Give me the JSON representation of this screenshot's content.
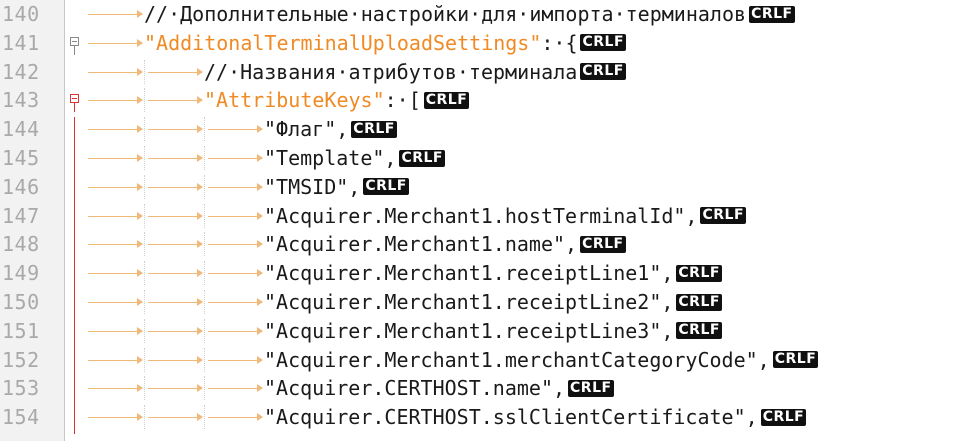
{
  "editor": {
    "eol_marker": "CRLF",
    "lines": [
      {
        "num": "140",
        "indent": 1,
        "fold": "",
        "parts": [
          {
            "type": "comment",
            "text": "//·Дополнительные·настройки·для·импорта·терминалов"
          }
        ]
      },
      {
        "num": "141",
        "indent": 1,
        "fold": "open-gray",
        "parts": [
          {
            "type": "key",
            "text": "\"AdditonalTerminalUploadSettings\""
          },
          {
            "type": "punct",
            "text": ":·{"
          }
        ]
      },
      {
        "num": "142",
        "indent": 2,
        "fold": "",
        "parts": [
          {
            "type": "comment",
            "text": "//·Названия·атрибутов·терминала"
          }
        ]
      },
      {
        "num": "143",
        "indent": 2,
        "fold": "open-red",
        "parts": [
          {
            "type": "key",
            "text": "\"AttributeKeys\""
          },
          {
            "type": "punct",
            "text": ":·["
          }
        ]
      },
      {
        "num": "144",
        "indent": 3,
        "fold": "line",
        "parts": [
          {
            "type": "str",
            "text": "\"Флаг\","
          }
        ]
      },
      {
        "num": "145",
        "indent": 3,
        "fold": "line",
        "parts": [
          {
            "type": "str",
            "text": "\"Template\","
          }
        ]
      },
      {
        "num": "146",
        "indent": 3,
        "fold": "line",
        "parts": [
          {
            "type": "str",
            "text": "\"TMSID\","
          }
        ]
      },
      {
        "num": "147",
        "indent": 3,
        "fold": "line",
        "parts": [
          {
            "type": "str",
            "text": "\"Acquirer.Merchant1.hostTerminalId\","
          }
        ]
      },
      {
        "num": "148",
        "indent": 3,
        "fold": "line",
        "parts": [
          {
            "type": "str",
            "text": "\"Acquirer.Merchant1.name\","
          }
        ]
      },
      {
        "num": "149",
        "indent": 3,
        "fold": "line",
        "parts": [
          {
            "type": "str",
            "text": "\"Acquirer.Merchant1.receiptLine1\","
          }
        ]
      },
      {
        "num": "150",
        "indent": 3,
        "fold": "line",
        "parts": [
          {
            "type": "str",
            "text": "\"Acquirer.Merchant1.receiptLine2\","
          }
        ]
      },
      {
        "num": "151",
        "indent": 3,
        "fold": "line",
        "parts": [
          {
            "type": "str",
            "text": "\"Acquirer.Merchant1.receiptLine3\","
          }
        ]
      },
      {
        "num": "152",
        "indent": 3,
        "fold": "line",
        "parts": [
          {
            "type": "str",
            "text": "\"Acquirer.Merchant1.merchantCategoryCode\","
          }
        ]
      },
      {
        "num": "153",
        "indent": 3,
        "fold": "line",
        "parts": [
          {
            "type": "str",
            "text": "\"Acquirer.CERTHOST.name\","
          }
        ]
      },
      {
        "num": "154",
        "indent": 3,
        "fold": "line",
        "parts": [
          {
            "type": "str",
            "text": "\"Acquirer.CERTHOST.sslClientCertificate\","
          }
        ]
      }
    ]
  }
}
